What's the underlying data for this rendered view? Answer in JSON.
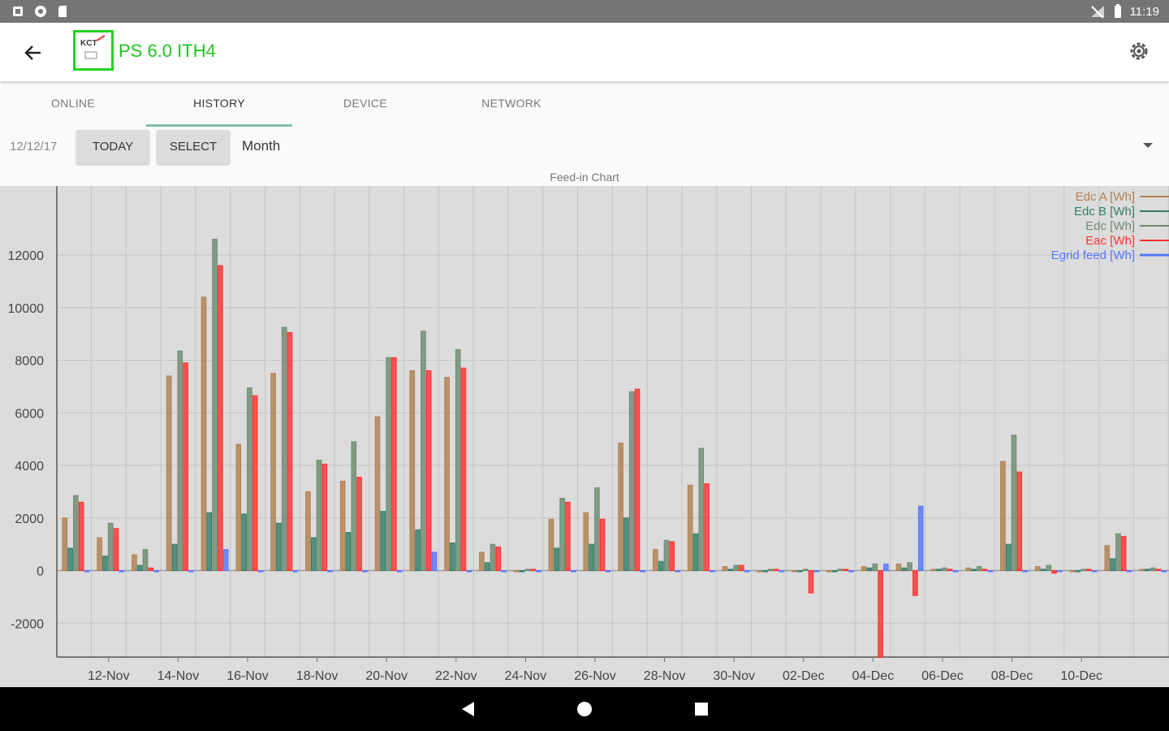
{
  "status_bar": {
    "time": "11:19"
  },
  "app_bar": {
    "title": "PS 6.0 ITH4",
    "logo_text": "KCT"
  },
  "tabs": [
    {
      "label": "ONLINE",
      "active": false
    },
    {
      "label": "HISTORY",
      "active": true
    },
    {
      "label": "DEVICE",
      "active": false
    },
    {
      "label": "NETWORK",
      "active": false
    }
  ],
  "toolbar": {
    "date": "12/12/17",
    "today_label": "TODAY",
    "select_label": "SELECT",
    "period": "Month"
  },
  "icons": {
    "back": "arrow-left-icon",
    "settings": "gear-icon",
    "nav_back": "triangle-back-icon",
    "nav_home": "circle-home-icon",
    "nav_recents": "square-recents-icon"
  },
  "colors": {
    "edc_a": "#b08050",
    "edc_b": "#2f7e6a",
    "edc": "#6e8a70",
    "eac": "#ff3030",
    "egrid": "#5577ff",
    "title_green": "#22c322"
  },
  "chart_data": {
    "type": "bar",
    "title": "Feed-in Chart",
    "ylim": [
      -3300,
      14000
    ],
    "y_ticks": [
      12000,
      10000,
      8000,
      6000,
      4000,
      2000,
      0,
      -2000
    ],
    "x_ticks": [
      "12-Nov",
      "14-Nov",
      "16-Nov",
      "18-Nov",
      "20-Nov",
      "22-Nov",
      "24-Nov",
      "26-Nov",
      "28-Nov",
      "30-Nov",
      "02-Dec",
      "04-Dec",
      "06-Dec",
      "08-Dec",
      "10-Dec"
    ],
    "legend_position": "top-right",
    "grid": true,
    "categories": [
      "11-Nov",
      "12-Nov",
      "13-Nov",
      "14-Nov",
      "15-Nov",
      "16-Nov",
      "17-Nov",
      "18-Nov",
      "19-Nov",
      "20-Nov",
      "21-Nov",
      "22-Nov",
      "23-Nov",
      "24-Nov",
      "25-Nov",
      "26-Nov",
      "27-Nov",
      "28-Nov",
      "29-Nov",
      "30-Nov",
      "01-Dec",
      "02-Dec",
      "03-Dec",
      "04-Dec",
      "05-Dec",
      "06-Dec",
      "07-Dec",
      "08-Dec",
      "09-Dec",
      "10-Dec",
      "11-Dec",
      "12-Dec"
    ],
    "series": [
      {
        "name": "Edc A [Wh]",
        "values": [
          2000,
          1250,
          600,
          7400,
          10400,
          4800,
          7500,
          3000,
          3400,
          5850,
          7600,
          7350,
          700,
          0,
          1950,
          2200,
          4850,
          800,
          3250,
          150,
          0,
          0,
          0,
          150,
          250,
          50,
          100,
          4150,
          150,
          0,
          950,
          50
        ]
      },
      {
        "name": "Edc B [Wh]",
        "values": [
          850,
          550,
          200,
          1000,
          2200,
          2150,
          1800,
          1250,
          1450,
          2250,
          1550,
          1050,
          300,
          0,
          850,
          1000,
          2000,
          350,
          1400,
          50,
          0,
          0,
          0,
          100,
          100,
          50,
          50,
          1000,
          50,
          0,
          450,
          50
        ]
      },
      {
        "name": "Edc [Wh]",
        "values": [
          2850,
          1800,
          800,
          8350,
          12600,
          6950,
          9250,
          4200,
          4900,
          8100,
          9100,
          8400,
          1000,
          50,
          2750,
          3150,
          6800,
          1150,
          4650,
          200,
          50,
          50,
          50,
          250,
          300,
          100,
          150,
          5150,
          200,
          50,
          1400,
          100
        ]
      },
      {
        "name": "Eac [Wh]",
        "values": [
          2600,
          1600,
          100,
          7900,
          11600,
          6650,
          9050,
          4050,
          3550,
          8100,
          7600,
          7700,
          900,
          50,
          2600,
          1950,
          6900,
          1100,
          3300,
          200,
          50,
          -850,
          50,
          -3300,
          -950,
          50,
          50,
          3750,
          -100,
          50,
          1300,
          50
        ]
      },
      {
        "name": "Egrid feed [Wh]",
        "values": [
          0,
          0,
          0,
          0,
          800,
          0,
          0,
          0,
          0,
          0,
          700,
          0,
          0,
          0,
          0,
          0,
          0,
          0,
          0,
          0,
          0,
          0,
          0,
          250,
          2450,
          0,
          0,
          0,
          0,
          0,
          0,
          0
        ]
      }
    ]
  }
}
